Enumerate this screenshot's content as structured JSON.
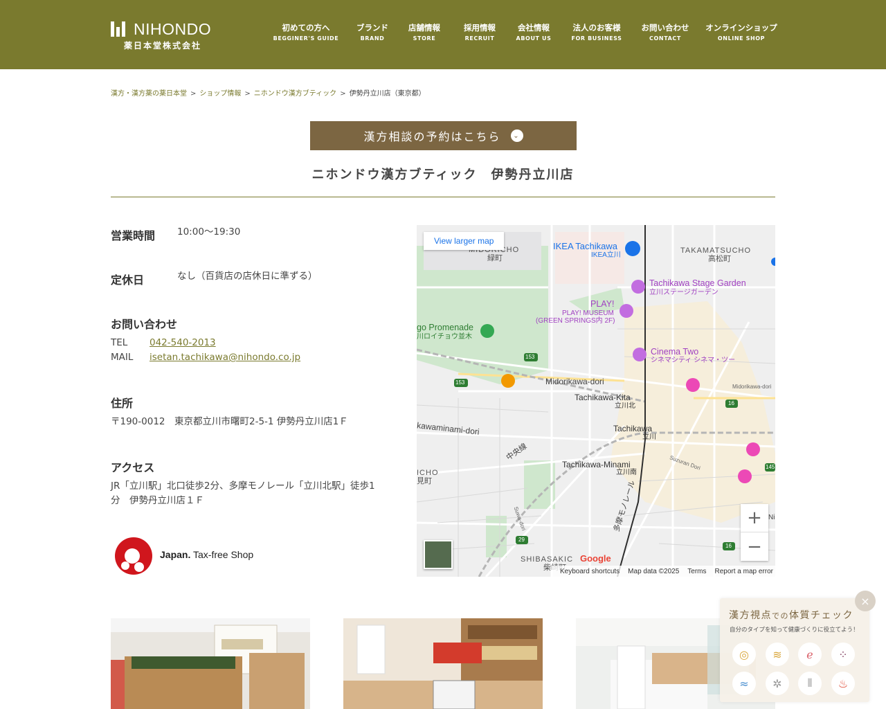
{
  "header": {
    "logo_text": "NIHONDO",
    "logo_sub": "薬日本堂株式会社",
    "nav": [
      {
        "ja": "初めての方へ",
        "en": "BEGGINER'S GUIDE"
      },
      {
        "ja": "ブランド",
        "en": "BRAND"
      },
      {
        "ja": "店舗情報",
        "en": "STORE"
      },
      {
        "ja": "採用情報",
        "en": "RECRUIT"
      },
      {
        "ja": "会社情報",
        "en": "ABOUT US"
      },
      {
        "ja": "法人のお客様",
        "en": "FOR BUSINESS"
      },
      {
        "ja": "お問い合わせ",
        "en": "CONTACT"
      },
      {
        "ja": "オンラインショップ",
        "en": "ONLINE SHOP"
      }
    ]
  },
  "breadcrumb": {
    "items": [
      "漢方・漢方薬の薬日本堂",
      "ショップ情報",
      "ニホンドウ漢方ブティック"
    ],
    "current": "伊勢丹立川店（東京都）",
    "sep": ">"
  },
  "reserve": {
    "label": "漢方相談の予約はこちら",
    "chevron": "⌄"
  },
  "page_title": "ニホンドウ漢方ブティック　伊勢丹立川店",
  "info": {
    "hours_label": "営業時間",
    "hours_value": "10:00～19:30",
    "closed_label": "定休日",
    "closed_value": "なし（百貨店の店休日に準ずる）",
    "contact_label": "お問い合わせ",
    "tel_label": "TEL",
    "tel_value": "042-540-2013",
    "mail_label": "MAIL",
    "mail_value": "isetan.tachikawa@nihondo.co.jp",
    "address_label": "住所",
    "address_value": "〒190-0012　東京都立川市曙町2-5-1 伊勢丹立川店1Ｆ",
    "access_label": "アクセス",
    "access_value": "JR「立川駅」北口徒歩2分、多摩モノレール「立川北駅」徒歩1分　伊勢丹立川店１Ｆ"
  },
  "tax_free": {
    "brand": "Japan.",
    "text": " Tax-free Shop"
  },
  "map": {
    "view_larger": "View larger map",
    "zoom_in": "+",
    "zoom_out": "−",
    "google": "Google",
    "footer": [
      "Keyboard shortcuts",
      "Map data ©2025",
      "Terms",
      "Report a map error"
    ],
    "labels": {
      "midoricho": "MIDORICHO",
      "midoricho_ja": "緑町",
      "ikea": "IKEA Tachikawa",
      "ikea_ja": "IKEA立川",
      "takamatsucho": "TAKAMATSUCHO",
      "takamatsucho_ja": "高松町",
      "stage_garden": "Tachikawa Stage Garden",
      "stage_garden_ja": "立川ステージガーデン",
      "play": "PLAY!",
      "play_museum": "PLAY! MUSEUM",
      "play_museum_2": "(GREEN SPRINGS内 2F)",
      "promenade": "go Promenade",
      "promenade_ja": "川ロイチョウ並木",
      "cinema": "Cinema Two",
      "cinema_ja": "シネマシティ シネマ・ツー",
      "midorikawa_dori": "Midorikawa-dori",
      "midorikawa_dori_small": "Midorikawa-dori",
      "kita": "Tachikawa-Kita",
      "kita_ja": "立川北",
      "tachikawa": "Tachikawa",
      "tachikawa_ja": "立川",
      "kawaminami": "kawaminami-dori",
      "chuo": "中央線",
      "minami": "Tachikawa-Minami",
      "minami_ja": "立川南",
      "icho": "ICHO",
      "icho_ja": "見町",
      "suzuran": "Suzuran Dori",
      "monorail": "多摩モノレール",
      "shibasaki": "SHIBASAKIC",
      "shibasaki_ja": "柴崎町",
      "suwa": "Suwa-dori",
      "r153a": "153",
      "r153b": "153",
      "r16a": "16",
      "r16b": "16",
      "r29": "29",
      "r145": "145",
      "ni": "Ni"
    }
  },
  "widget": {
    "title_main": "漢方視点",
    "title_small": "での",
    "title_end": "体質チェック",
    "subtitle": "自分のタイプを知って健康づくりに役立てよう！",
    "close": "×",
    "icons": [
      "qi-deficiency-icon",
      "qi-stagnation-icon",
      "blood-deficiency-icon",
      "blood-stasis-icon",
      "fluid-icon",
      "yin-deficiency-icon",
      "dryness-icon",
      "heat-icon"
    ]
  },
  "colors": {
    "brand_olive": "#7a7a2e",
    "brown": "#7c6642",
    "link": "#7a7a2e"
  }
}
